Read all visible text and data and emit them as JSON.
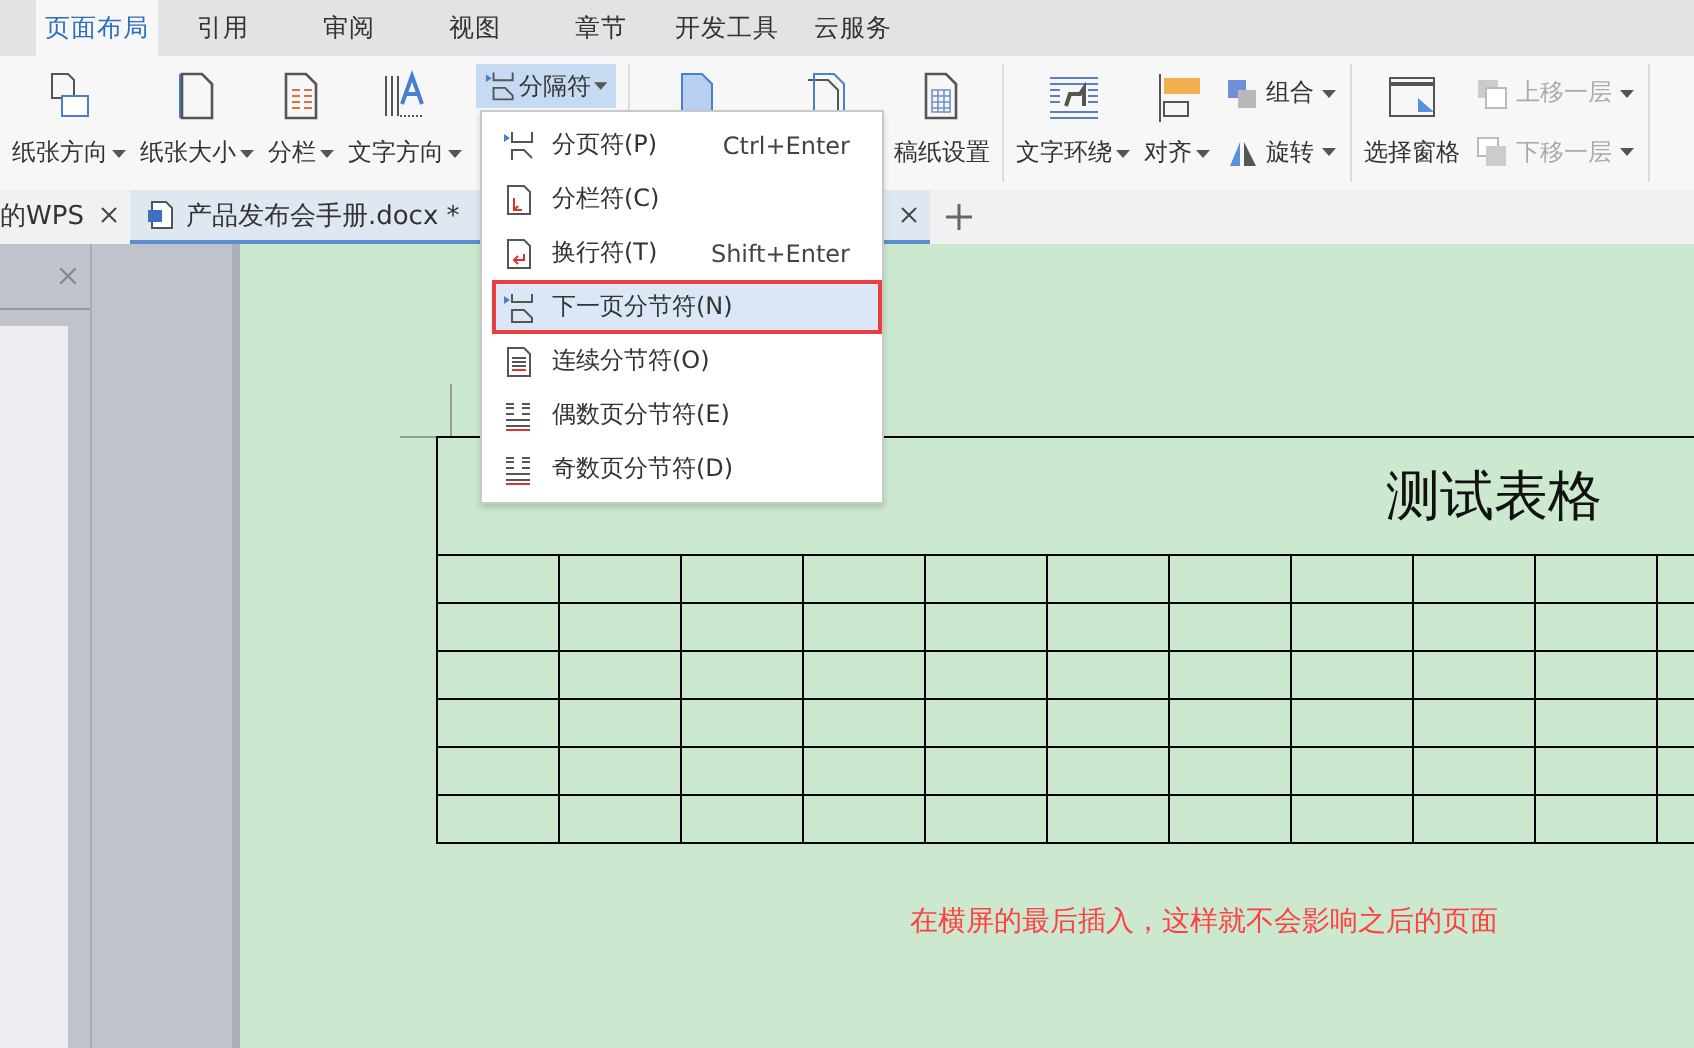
{
  "ribbon_tabs": [
    {
      "label": "页面布局",
      "selected": true
    },
    {
      "label": "引用",
      "selected": false
    },
    {
      "label": "审阅",
      "selected": false
    },
    {
      "label": "视图",
      "selected": false
    },
    {
      "label": "章节",
      "selected": false
    },
    {
      "label": "开发工具",
      "selected": false
    },
    {
      "label": "云服务",
      "selected": false
    }
  ],
  "ribbon": {
    "groups": [
      {
        "items": [
          {
            "kind": "large",
            "label": "纸张方向",
            "dropdown": true
          },
          {
            "kind": "large",
            "label": "纸张大小",
            "dropdown": true
          },
          {
            "kind": "large",
            "label": "分栏",
            "dropdown": true
          },
          {
            "kind": "large",
            "label": "文字方向",
            "dropdown": true
          },
          {
            "kind": "split",
            "label": "分隔符",
            "dropdown": true,
            "expanded": true
          }
        ]
      },
      {
        "items": [
          {
            "kind": "icon"
          },
          {
            "kind": "icon"
          },
          {
            "kind": "large",
            "label": "稿纸设置",
            "dropdown": false
          }
        ]
      },
      {
        "items": [
          {
            "kind": "large",
            "label": "文字环绕",
            "dropdown": true
          },
          {
            "kind": "large",
            "label": "对齐",
            "dropdown": true
          },
          {
            "kind": "stack",
            "items": [
              {
                "label": "组合",
                "dropdown": true,
                "disabled": false
              },
              {
                "label": "旋转",
                "dropdown": true,
                "disabled": false
              }
            ]
          }
        ]
      },
      {
        "items": [
          {
            "kind": "large",
            "label": "选择窗格",
            "dropdown": false
          },
          {
            "kind": "stack",
            "items": [
              {
                "label": "上移一层",
                "dropdown": true,
                "disabled": true
              },
              {
                "label": "下移一层",
                "dropdown": true,
                "disabled": true
              }
            ]
          }
        ]
      }
    ]
  },
  "document_tabs": [
    {
      "label": "的WPS",
      "selected": false
    },
    {
      "label": "产品发布会手册.docx *",
      "selected": true
    }
  ],
  "break_menu": {
    "items": [
      {
        "label": "分页符(P)",
        "shortcut": "Ctrl+Enter",
        "selected": false,
        "boxed": false
      },
      {
        "label": "分栏符(C)",
        "selected": false,
        "boxed": false
      },
      {
        "label": "换行符(T)",
        "shortcut": "Shift+Enter",
        "selected": false,
        "boxed": false
      },
      {
        "label": "下一页分节符(N)",
        "selected": true,
        "boxed": true
      },
      {
        "label": "连续分节符(O)",
        "selected": false,
        "boxed": false
      },
      {
        "label": "偶数页分节符(E)",
        "selected": false,
        "boxed": false
      },
      {
        "label": "奇数页分节符(D)",
        "selected": false,
        "boxed": false
      }
    ]
  },
  "document": {
    "table_title": "测试表格",
    "note": "在横屏的最后插入，这样就不会影响之后的页面"
  }
}
